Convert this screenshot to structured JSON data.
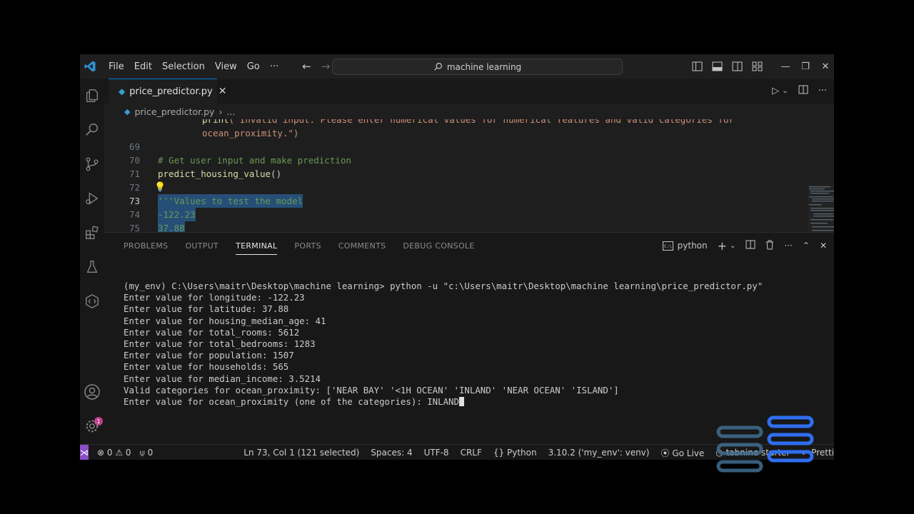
{
  "menu": {
    "file": "File",
    "edit": "Edit",
    "selection": "Selection",
    "view": "View",
    "go": "Go",
    "more": "···"
  },
  "command_center": {
    "label": "machine learning"
  },
  "tab": {
    "label": "price_predictor.py",
    "lang_tag": "py"
  },
  "breadcrumb": {
    "file": "price_predictor.py",
    "sep": "›",
    "more": "..."
  },
  "code_lines": [
    {
      "ln": "",
      "text_pre": "    ",
      "fn": "print",
      "str": "(\"Invalid input. Please enter numerical values for numerical features and valid categories for"
    },
    {
      "ln": "",
      "str": "ocean_proximity.\")"
    },
    {
      "ln": "69",
      "text": ""
    },
    {
      "ln": "70",
      "comment": "# Get user input and make prediction"
    },
    {
      "ln": "71",
      "fn": "predict_housing_value",
      "rest": "()"
    },
    {
      "ln": "72",
      "text": ""
    },
    {
      "ln": "73",
      "selected": "'''Values to test the model"
    },
    {
      "ln": "74",
      "selected": "-122.23"
    },
    {
      "ln": "75",
      "selected": "37.88"
    }
  ],
  "panel_tabs": [
    "PROBLEMS",
    "OUTPUT",
    "TERMINAL",
    "PORTS",
    "COMMENTS",
    "DEBUG CONSOLE"
  ],
  "panel_active": "TERMINAL",
  "terminal_profile": "python",
  "terminal_lines": [
    "(my_env) C:\\Users\\maitr\\Desktop\\machine learning> python -u \"c:\\Users\\maitr\\Desktop\\machine learning\\price_predictor.py\"",
    "Enter value for longitude: -122.23",
    "Enter value for latitude: 37.88",
    "Enter value for housing_median_age: 41",
    "Enter value for total_rooms: 5612",
    "Enter value for total_bedrooms: 1283",
    "Enter value for population: 1507",
    "Enter value for households: 565",
    "Enter value for median_income: 3.5214",
    "Valid categories for ocean_proximity: ['NEAR BAY' '<1H OCEAN' 'INLAND' 'NEAR OCEAN' 'ISLAND']",
    "Enter value for ocean_proximity (one of the categories): INLAND"
  ],
  "status": {
    "errors": "⊗ 0 ⚠ 0",
    "ports": "0",
    "position": "Ln 73, Col 1 (121 selected)",
    "spaces": "Spaces: 4",
    "encoding": "UTF-8",
    "eol": "CRLF",
    "language": "Python",
    "interpreter": "3.10.2 ('my_env': venv)",
    "golive": "Go Live",
    "tabnine": "tabnine starter",
    "prettier": "Prettier"
  },
  "accounts_badge": "1",
  "colors": {
    "accent": "#0078d4",
    "remote": "#8a4fc6",
    "badge": "#c33d8a"
  }
}
